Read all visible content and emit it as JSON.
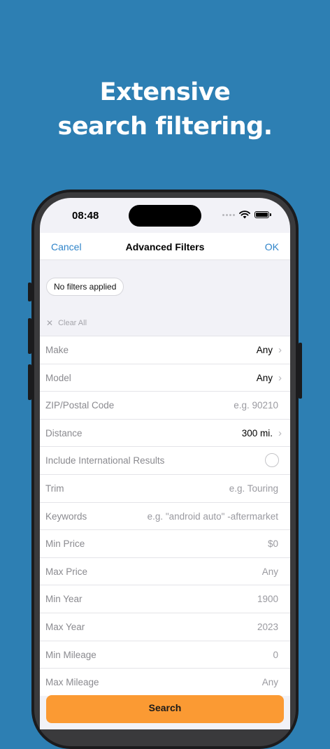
{
  "headline": {
    "line1": "Extensive",
    "line2": "search filtering."
  },
  "status_bar": {
    "time": "08:48"
  },
  "nav": {
    "cancel": "Cancel",
    "title": "Advanced Filters",
    "ok": "OK"
  },
  "filters_chip": "No filters applied",
  "clear_all": "Clear All",
  "rows": [
    {
      "label": "Make",
      "value": "Any",
      "type": "select"
    },
    {
      "label": "Model",
      "value": "Any",
      "type": "select"
    },
    {
      "label": "ZIP/Postal Code",
      "placeholder": "e.g. 90210",
      "type": "input"
    },
    {
      "label": "Distance",
      "value": "300 mi.",
      "type": "select"
    },
    {
      "label": "Include International Results",
      "type": "toggle",
      "checked": false
    },
    {
      "label": "Trim",
      "placeholder": "e.g. Touring",
      "type": "input"
    },
    {
      "label": "Keywords",
      "placeholder": "e.g. \"android auto\" -aftermarket",
      "type": "input"
    },
    {
      "label": "Min Price",
      "placeholder": "$0",
      "type": "input"
    },
    {
      "label": "Max Price",
      "placeholder": "Any",
      "type": "input"
    },
    {
      "label": "Min Year",
      "placeholder": "1900",
      "type": "input"
    },
    {
      "label": "Max Year",
      "placeholder": "2023",
      "type": "input"
    },
    {
      "label": "Min Mileage",
      "placeholder": "0",
      "type": "input"
    },
    {
      "label": "Max Mileage",
      "placeholder": "Any",
      "type": "input"
    }
  ],
  "search_button": "Search",
  "colors": {
    "background": "#2d7fb3",
    "accent": "#2f84c9",
    "search_button": "#fb9a33"
  }
}
